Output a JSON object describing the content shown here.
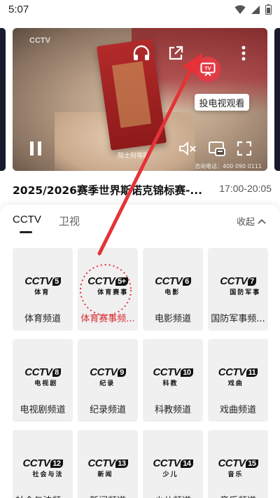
{
  "status_bar": {
    "time": "5:07"
  },
  "video": {
    "watermark": "CCTV",
    "caption": "院士何尊融",
    "hotline": "咨询电话：400 090 0111",
    "tooltip": "投电视观看",
    "icons": [
      "headphones-icon",
      "share-icon",
      "tv-cast-icon",
      "more-icon",
      "pause-icon",
      "mute-icon",
      "pip-icon",
      "fullscreen-icon"
    ]
  },
  "program": {
    "title": "2025/2026赛季世界斯诺克锦标赛-...",
    "time": "17:00-20:05"
  },
  "tabs": [
    {
      "label": "CCTV",
      "active": true
    },
    {
      "label": "卫视",
      "active": false
    }
  ],
  "collapse_label": "收起",
  "channels": [
    {
      "num": "5",
      "sub": "体育",
      "name": "体育频道"
    },
    {
      "num": "5+",
      "sub": "体育赛事",
      "name": "体育赛事频...",
      "selected": true
    },
    {
      "num": "6",
      "sub": "电影",
      "name": "电影频道"
    },
    {
      "num": "7",
      "sub": "国防军事",
      "name": "国防军事频..."
    },
    {
      "num": "8",
      "sub": "电视剧",
      "name": "电视剧频道"
    },
    {
      "num": "9",
      "sub": "纪录",
      "name": "纪录频道"
    },
    {
      "num": "10",
      "sub": "科教",
      "name": "科教频道"
    },
    {
      "num": "11",
      "sub": "戏曲",
      "name": "戏曲频道"
    },
    {
      "num": "12",
      "sub": "社会与法",
      "name": "社会与法频..."
    },
    {
      "num": "13",
      "sub": "新闻",
      "name": "新闻频道"
    },
    {
      "num": "14",
      "sub": "少儿",
      "name": "少儿频道"
    },
    {
      "num": "15",
      "sub": "音乐",
      "name": "音乐频道"
    }
  ],
  "colors": {
    "accent": "#e33b45",
    "selected_text": "#d62b34"
  }
}
